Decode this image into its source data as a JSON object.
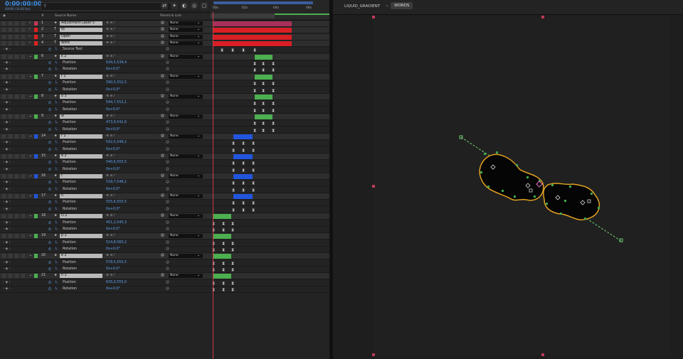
{
  "timeline": {
    "timecode": "0:00:00:00",
    "fps": "00000 (30.00 fps)",
    "search_icon": "search-icon",
    "columns": {
      "num": "#",
      "source_name": "Source Name",
      "parent": "Parent & Link"
    },
    "ruler": {
      "t0": "00s",
      "t1": "02s",
      "t2": "04s",
      "t3": "06s"
    },
    "layers": [
      {
        "num": "1",
        "name": "Adjustment Layer 5",
        "color": "#c0395a",
        "parent": "None"
      },
      {
        "num": "2",
        "name": "to",
        "color": "#e02020",
        "parent": "None"
      },
      {
        "num": "3",
        "name": "Open",
        "color": "#e02020",
        "parent": "None"
      },
      {
        "num": "4",
        "name": "Work",
        "color": "#e02020",
        "parent": "None"
      }
    ],
    "source_text": "Source Text",
    "groups": [
      {
        "num": "6",
        "name": "k 2",
        "color": "#4caf50",
        "pos": "634,5,539,4",
        "rot": "0x+0,0°"
      },
      {
        "num": "7",
        "name": "r 2",
        "color": "#4caf50",
        "pos": "590,5,552,5",
        "rot": "0x+0,0°"
      },
      {
        "num": "8",
        "name": "o 3",
        "color": "#4caf50",
        "pos": "544,7,553,1",
        "rot": "0x+0,0°"
      },
      {
        "num": "9",
        "name": "w",
        "color": "#4caf50",
        "pos": "473,9,542,6",
        "rot": "0x+0,0°"
      },
      {
        "num": "14",
        "name": "r 2",
        "color": "#2255dd",
        "pos": "542,5,548,2",
        "rot": "0x+0,0°"
      },
      {
        "num": "15",
        "name": "e 2",
        "color": "#2255dd",
        "pos": "540,6,555,5",
        "rot": "0x+0,0°"
      },
      {
        "num": "16",
        "name": "t",
        "color": "#2255dd",
        "pos": "518,7,548,2",
        "rot": "0x+0,0°"
      },
      {
        "num": "17",
        "name": "n",
        "color": "#2255dd",
        "pos": "555,6,555,5",
        "rot": "0x+0,0°"
      },
      {
        "num": "18",
        "name": "O 2",
        "color": "#4caf50",
        "pos": "451,2,545,3",
        "rot": "0x+0,0°"
      },
      {
        "num": "19",
        "name": "p 2",
        "color": "#4caf50",
        "pos": "514,8,565,2",
        "rot": "0x+0,0°"
      },
      {
        "num": "20",
        "name": "e 2",
        "color": "#4caf50",
        "pos": "578,5,555,5",
        "rot": "0x+0,0°"
      },
      {
        "num": "21",
        "name": "n 2",
        "color": "#4caf50",
        "pos": "635,0,555,0",
        "rot": "0x+0,0°"
      }
    ],
    "prop_position": "Position",
    "prop_rotation": "Rotation",
    "parent_none": "None"
  },
  "viewer": {
    "tab1": "LIQUID_GRADIENT",
    "tab2": "WORDS"
  },
  "colors": {
    "accent": "#3f8fe6",
    "playhead": "#d03a4a",
    "shape_stroke": "#e0a020"
  }
}
